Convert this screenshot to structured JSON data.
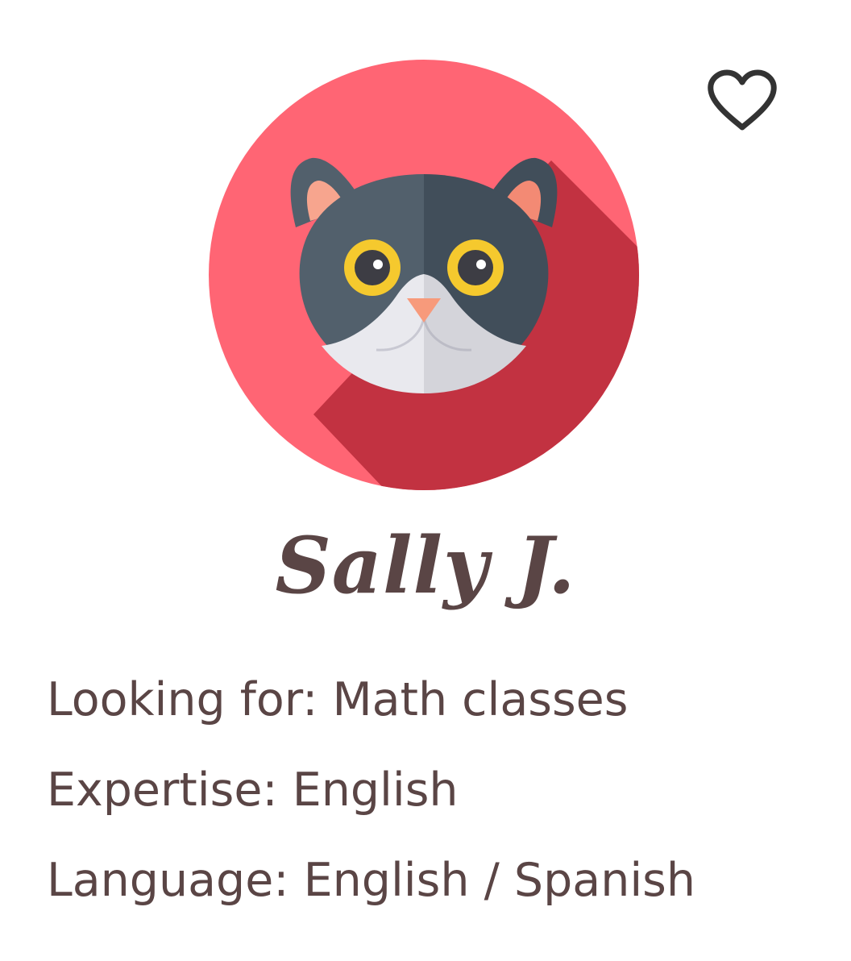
{
  "profile": {
    "name": "Sally J.",
    "avatar_icon": "cat-avatar-icon",
    "favorite_icon": "heart-outline-icon",
    "details": [
      {
        "label": "Looking for:",
        "value": "Math classes"
      },
      {
        "label": "Expertise:",
        "value": "English"
      },
      {
        "label": "Language:",
        "value": "English / Spanish"
      }
    ]
  },
  "colors": {
    "avatar_background": "#ff6574",
    "avatar_shadow": "#c23241",
    "cat_fur_light": "#52606c",
    "cat_fur_dark": "#414e5a",
    "cat_eye_ring": "#f5c92e",
    "cat_nose": "#f79a7b",
    "cat_ear_inner": "#f7a58e",
    "cat_muzzle": "#e9e9ee",
    "text": "#5a4545",
    "heart_stroke": "#333333"
  }
}
